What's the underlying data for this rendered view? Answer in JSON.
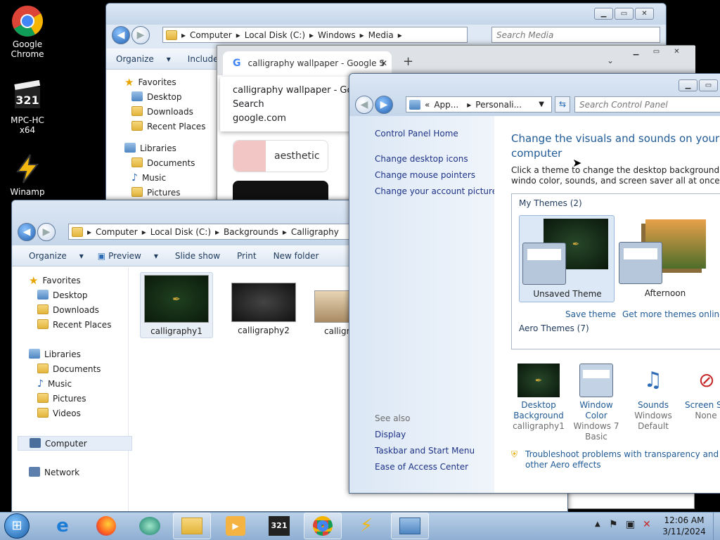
{
  "desktop": {
    "icons": [
      {
        "label": "Google Chrome"
      },
      {
        "label": "MPC-HC x64"
      },
      {
        "label": "Winamp"
      }
    ]
  },
  "media_window": {
    "address": [
      "Computer",
      "Local Disk (C:)",
      "Windows",
      "Media"
    ],
    "search_placeholder": "Search Media",
    "toolbar": [
      "Organize",
      "Include"
    ],
    "nav": [
      "Favorites",
      "Desktop",
      "Downloads",
      "Recent Places",
      "Libraries",
      "Documents",
      "Music",
      "Pictures"
    ]
  },
  "chrome_window": {
    "tab_title": "calligraphy wallpaper - Google S",
    "suggest_title": "calligraphy wallpaper - Goog",
    "suggest_sub": "Search",
    "suggest_site": "google.com",
    "chip": "aesthetic"
  },
  "calligraphy_window": {
    "address": [
      "Computer",
      "Local Disk (C:)",
      "Backgrounds",
      "Calligraphy"
    ],
    "toolbar": [
      "Organize",
      "Preview",
      "Slide show",
      "Print",
      "New folder"
    ],
    "nav": {
      "favorites": "Favorites",
      "desktop": "Desktop",
      "downloads": "Downloads",
      "recent": "Recent Places",
      "libraries": "Libraries",
      "documents": "Documents",
      "music": "Music",
      "pictures": "Pictures",
      "videos": "Videos",
      "computer": "Computer",
      "network": "Network"
    },
    "files": [
      "calligraphy1",
      "calligraphy2",
      "calligra"
    ]
  },
  "control_panel": {
    "address": [
      "App...",
      "Personali..."
    ],
    "search_placeholder": "Search Control Panel",
    "side_links": [
      "Control Panel Home",
      "Change desktop icons",
      "Change mouse pointers",
      "Change your account picture"
    ],
    "see_also": "See also",
    "see_also_links": [
      "Display",
      "Taskbar and Start Menu",
      "Ease of Access Center"
    ],
    "heading": "Change the visuals and sounds on your computer",
    "description": "Click a theme to change the desktop background, windo color, sounds, and screen saver all at once.",
    "my_themes": "My Themes (2)",
    "themes": [
      "Unsaved Theme",
      "Afternoon"
    ],
    "save_theme": "Save theme",
    "get_more": "Get more themes online",
    "aero_themes": "Aero Themes (7)",
    "settings": [
      {
        "title": "Desktop Background",
        "value": "calligraphy1"
      },
      {
        "title": "Window Color",
        "value": "Windows 7 Basic"
      },
      {
        "title": "Sounds",
        "value": "Windows Default"
      },
      {
        "title": "Screen Sa",
        "value": "None"
      }
    ],
    "troubleshoot": "Troubleshoot problems with transparency and other Aero effects"
  },
  "taskbar": {
    "time": "12:06 AM",
    "date": "3/11/2024"
  },
  "colors": {
    "link": "#1e3287",
    "heading": "#1e5a96",
    "taskbar": "#9cb8d8"
  }
}
